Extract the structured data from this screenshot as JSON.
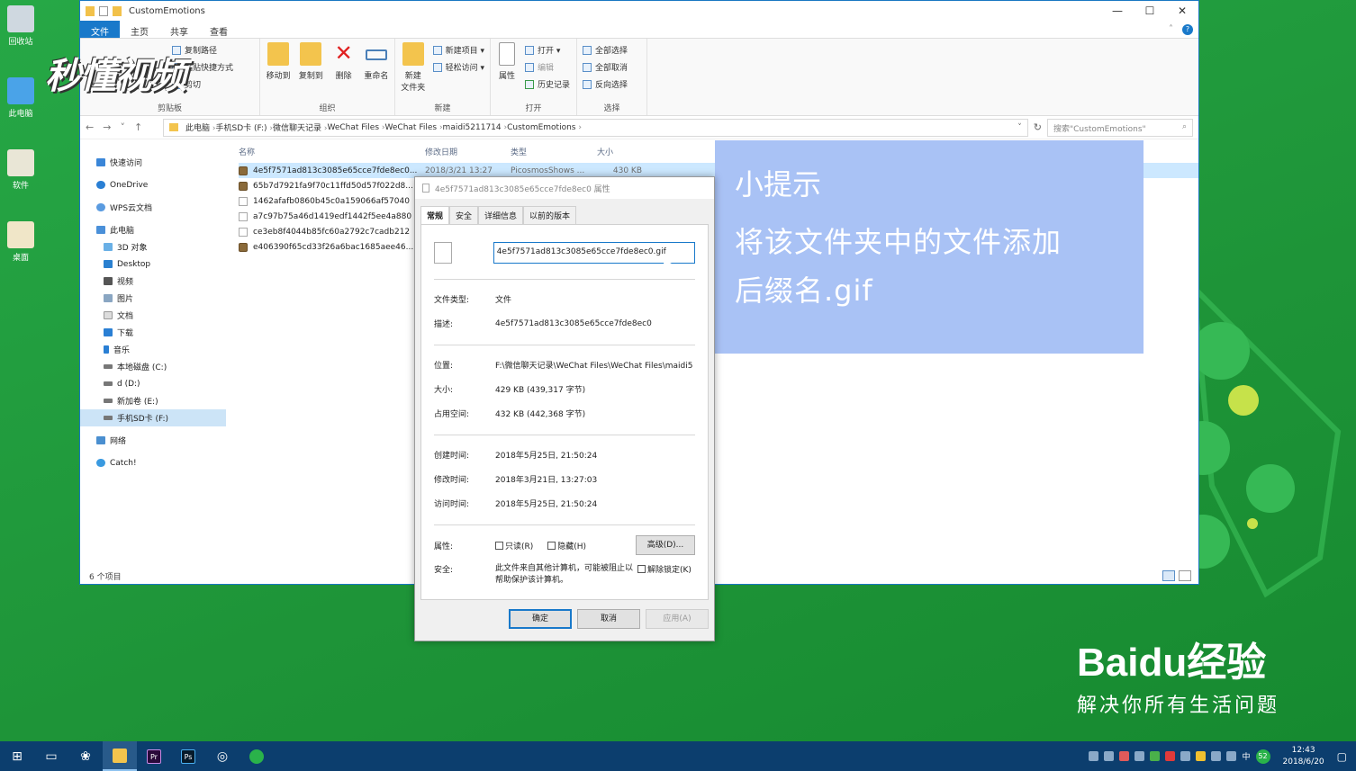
{
  "explorer": {
    "title": "CustomEmotions",
    "window_buttons": [
      "—",
      "☐",
      "✕"
    ],
    "tabs": [
      "文件",
      "主页",
      "共享",
      "查看"
    ],
    "ribbon": {
      "clipboard": {
        "name": "剪贴板",
        "items": [
          "剪切",
          "复制路径",
          "粘贴快捷方式"
        ]
      },
      "organize": {
        "name": "组织",
        "move_to": "移动到",
        "copy_to": "复制到",
        "delete": "删除",
        "rename": "重命名"
      },
      "new": {
        "name": "新建",
        "new_folder": "新建\n文件夹",
        "new_item": "新建项目 ▾",
        "easy_access": "轻松访问 ▾"
      },
      "open": {
        "name": "打开",
        "properties": "属性",
        "open": "打开 ▾",
        "edit": "编辑",
        "history": "历史记录"
      },
      "select": {
        "name": "选择",
        "select_all": "全部选择",
        "select_none": "全部取消",
        "invert": "反向选择"
      }
    },
    "breadcrumbs": [
      "此电脑",
      "手机SD卡 (F:)",
      "微信聊天记录",
      "WeChat Files",
      "WeChat Files",
      "maidi5211714",
      "CustomEmotions"
    ],
    "search_placeholder": "搜索\"CustomEmotions\"",
    "nav": [
      "快速访问",
      "OneDrive",
      "WPS云文档",
      "此电脑",
      "3D 对象",
      "Desktop",
      "视频",
      "图片",
      "文档",
      "下载",
      "音乐",
      "本地磁盘 (C:)",
      "d (D:)",
      "新加卷 (E:)",
      "手机SD卡 (F:)",
      "网络",
      "Catch!"
    ],
    "columns": [
      "名称",
      "修改日期",
      "类型",
      "大小"
    ],
    "files": [
      {
        "name": "4e5f7571ad813c3085e65cce7fde8ec0...",
        "date": "2018/3/21 13:27",
        "type": "PicosmosShows ...",
        "size": "430 KB"
      },
      {
        "name": "65b7d7921fa9f70c11ffd50d57f022d8..."
      },
      {
        "name": "1462afafb0860b45c0a159066af57040"
      },
      {
        "name": "a7c97b75a46d1419edf1442f5ee4a880"
      },
      {
        "name": "ce3eb8f4044b85fc60a2792c7cadb212"
      },
      {
        "name": "e406390f65cd33f26a6bac1685aee46..."
      }
    ],
    "status": "6 个项目"
  },
  "dialog": {
    "title": "4e5f7571ad813c3085e65cce7fde8ec0 属性",
    "tabs": [
      "常规",
      "安全",
      "详细信息",
      "以前的版本"
    ],
    "filename": "4e5f7571ad813c3085e65cce7fde8ec0.gif",
    "rows1": [
      {
        "label": "文件类型:",
        "value": "文件"
      },
      {
        "label": "描述:",
        "value": "4e5f7571ad813c3085e65cce7fde8ec0"
      }
    ],
    "rows2": [
      {
        "label": "位置:",
        "value": "F:\\微信聊天记录\\WeChat Files\\WeChat Files\\maidi5"
      },
      {
        "label": "大小:",
        "value": "429 KB (439,317 字节)"
      },
      {
        "label": "占用空间:",
        "value": "432 KB (442,368 字节)"
      }
    ],
    "rows3": [
      {
        "label": "创建时间:",
        "value": "2018年5月25日, 21:50:24"
      },
      {
        "label": "修改时间:",
        "value": "2018年3月21日, 13:27:03"
      },
      {
        "label": "访问时间:",
        "value": "2018年5月25日, 21:50:24"
      }
    ],
    "attr_label": "属性:",
    "readonly": "只读(R)",
    "hidden": "隐藏(H)",
    "advanced": "高级(D)...",
    "security_label": "安全:",
    "security_text": "此文件来自其他计算机，可能被阻止以帮助保护该计算机。",
    "unblock": "解除锁定(K)",
    "ok": "确定",
    "cancel": "取消",
    "apply": "应用(A)"
  },
  "tip": {
    "title": "小提示",
    "line1": "将该文件夹中的文件添加",
    "line2": "后缀名.gif"
  },
  "watermark": "秒懂视频",
  "baidu": {
    "brand": "Baidu经验",
    "slogan": "解决你所有生活问题"
  },
  "desktop_icons": [
    "回收站",
    "此电脑",
    "软件",
    "桌面"
  ],
  "taskbar": {
    "time": "12:43",
    "date": "2018/6/20",
    "ime": "中",
    "badge": "52",
    "pr": "Pr",
    "ps": "Ps"
  }
}
